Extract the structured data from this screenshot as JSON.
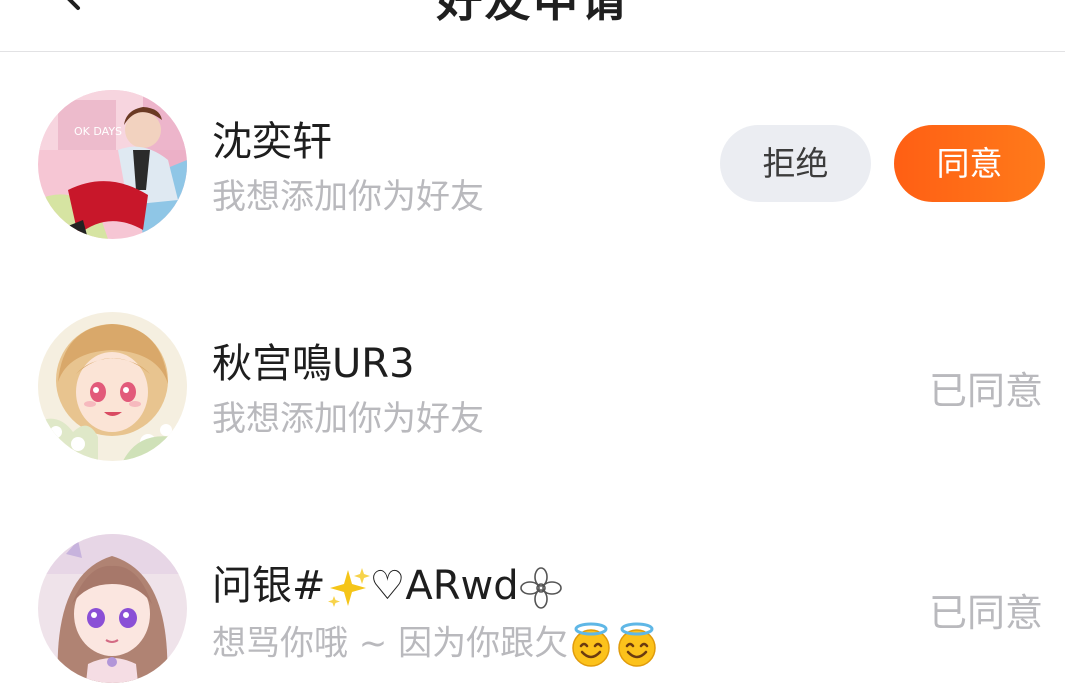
{
  "header": {
    "title": "好友申请",
    "back_icon": "chevron-left-icon"
  },
  "requests": [
    {
      "name": "沈奕轩",
      "message": "我想添加你为好友",
      "reject_label": "拒绝",
      "accept_label": "同意",
      "avatar_icon": "anime-boy-avatar"
    },
    {
      "name": "秋宫鳴UR3",
      "message": "我想添加你为好友",
      "status": "已同意",
      "avatar_icon": "anime-girl-blonde-avatar"
    },
    {
      "name_text": "问银#",
      "name_suffix": "♡ARwd",
      "message_text": "想骂你哦 ~ 因为你跟欠",
      "status": "已同意",
      "avatar_icon": "anime-girl-purple-eyes-avatar",
      "emoji_icons": [
        "sparkles-icon",
        "flower-icon",
        "smiling-face-with-halo-icon",
        "smiling-face-with-halo-icon"
      ]
    }
  ],
  "colors": {
    "accent": "#ff6416",
    "reject_bg": "#ebedf2",
    "secondary_text": "#b9b9bd",
    "divider": "#e2e2e4"
  }
}
